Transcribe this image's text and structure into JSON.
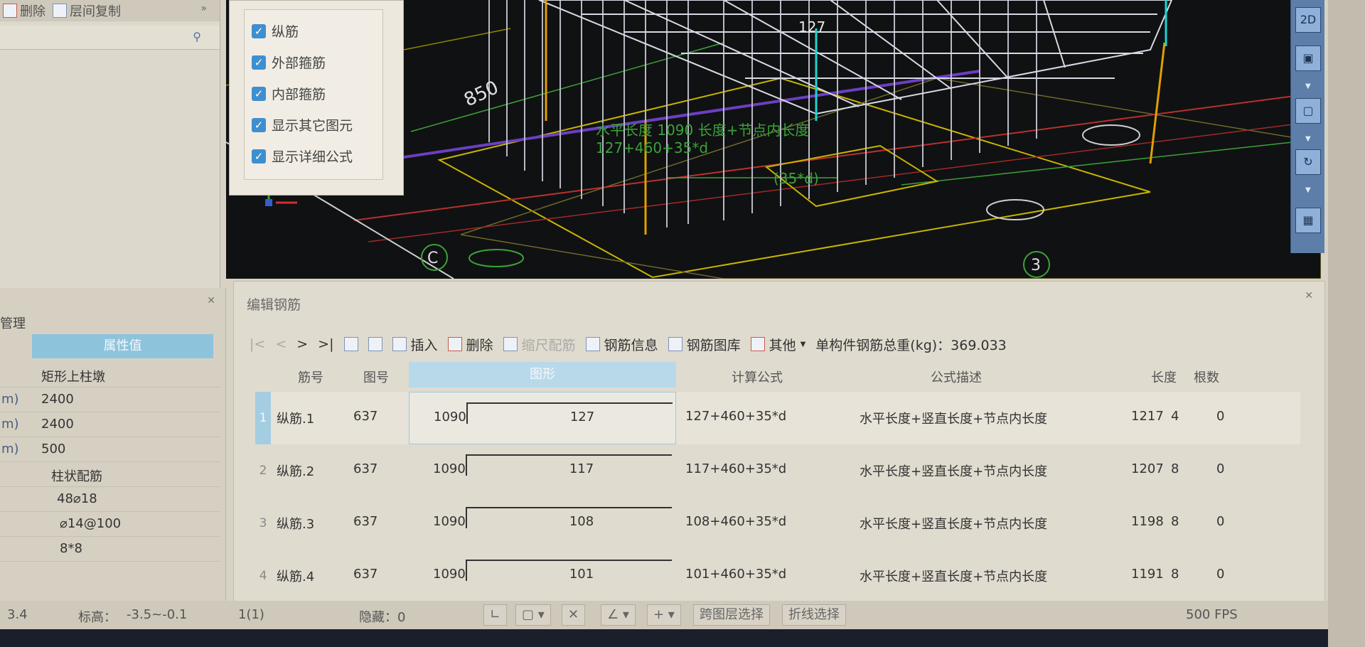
{
  "left_toolbar": {
    "delete_label": "删除",
    "copy_floor_label": "层间复制"
  },
  "layer_panel": {
    "items": [
      {
        "label": "纵筋",
        "checked": true
      },
      {
        "label": "外部箍筋",
        "checked": true
      },
      {
        "label": "内部箍筋",
        "checked": true
      },
      {
        "label": "显示其它图元",
        "checked": true
      },
      {
        "label": "显示详细公式",
        "checked": true
      }
    ]
  },
  "viewport": {
    "label_127": "127",
    "label_1090": "1090",
    "formula_desc": "水平长度 1090 长度+节点内长度",
    "formula": "127+460+35*d",
    "formula_sub": "(35*d)",
    "dim_850": "850",
    "grid_c": "C",
    "grid_3": "3"
  },
  "properties": {
    "title": "管理",
    "column_header": "属性值",
    "rows": [
      {
        "unit": "",
        "value": "矩形上柱墩"
      },
      {
        "unit": "m)",
        "value": "2400"
      },
      {
        "unit": "m)",
        "value": "2400"
      },
      {
        "unit": "m)",
        "value": "500"
      },
      {
        "unit": "",
        "value": "柱状配筋"
      },
      {
        "unit": "",
        "value": "48⌀18"
      },
      {
        "unit": "",
        "value": "⌀14@100"
      },
      {
        "unit": "",
        "value": "8*8"
      }
    ]
  },
  "rebar_panel": {
    "title": "编辑钢筋",
    "toolbar": {
      "insert": "插入",
      "delete": "删除",
      "scale_rebar": "缩尺配筋",
      "rebar_info": "钢筋信息",
      "rebar_library": "钢筋图库",
      "other": "其他",
      "total_weight": "单构件钢筋总重(kg)：369.033"
    },
    "columns": [
      "筋号",
      "图号",
      "图形",
      "计算公式",
      "公式描述",
      "长度",
      "根数"
    ],
    "rows": [
      {
        "idx": "1",
        "name": "纵筋.1",
        "fig": "637",
        "left": "1090",
        "mid": "127",
        "formula": "127+460+35*d",
        "desc": "水平长度+竖直长度+节点内长度",
        "length": "1217",
        "count": "4",
        "extra": "0"
      },
      {
        "idx": "2",
        "name": "纵筋.2",
        "fig": "637",
        "left": "1090",
        "mid": "117",
        "formula": "117+460+35*d",
        "desc": "水平长度+竖直长度+节点内长度",
        "length": "1207",
        "count": "8",
        "extra": "0"
      },
      {
        "idx": "3",
        "name": "纵筋.3",
        "fig": "637",
        "left": "1090",
        "mid": "108",
        "formula": "108+460+35*d",
        "desc": "水平长度+竖直长度+节点内长度",
        "length": "1198",
        "count": "8",
        "extra": "0"
      },
      {
        "idx": "4",
        "name": "纵筋.4",
        "fig": "637",
        "left": "1090",
        "mid": "101",
        "formula": "101+460+35*d",
        "desc": "水平长度+竖直长度+节点内长度",
        "length": "1191",
        "count": "8",
        "extra": "0"
      }
    ]
  },
  "statusbar": {
    "scale": "3.4",
    "elevation_label": "标高：",
    "elevation": "-3.5~-0.1",
    "count": "1(1)",
    "hidden": "隐藏：0",
    "cross_layer_select": "跨图层选择",
    "polyline_select": "折线选择",
    "fps": "500 FPS"
  }
}
